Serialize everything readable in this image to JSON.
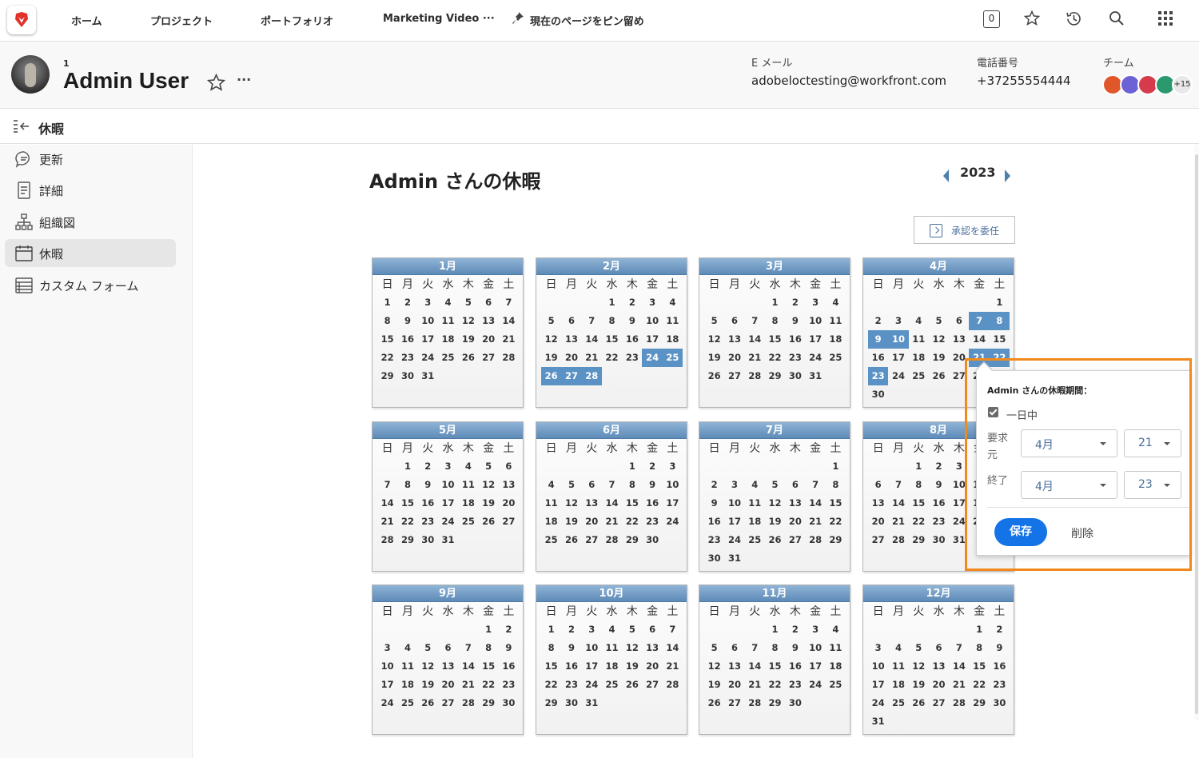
{
  "nav": {
    "items": [
      "ホーム",
      "プロジェクト",
      "ポートフォリオ",
      "Marketing Video ···"
    ],
    "pin_label": "現在のページをピン留め",
    "badge_count": "0",
    "icons": [
      "brand-logo-icon",
      "pin-icon",
      "star-icon",
      "history-icon",
      "search-icon",
      "apps-grid-icon"
    ]
  },
  "header": {
    "small_number": "1",
    "user_name": "Admin User",
    "more_label": "···",
    "email_label": "E メール",
    "email_value": "adobeloctesting@workfront.com",
    "phone_label": "電話番号",
    "phone_value": "+37255554444",
    "team_label": "チーム",
    "team_more": "+15",
    "team_colors": [
      "#e0572a",
      "#6b62d6",
      "#d63b4d",
      "#2a9a6e"
    ]
  },
  "section": {
    "title": "休暇"
  },
  "sidebar": {
    "items": [
      {
        "label": "更新",
        "icon": "chat-bubble-icon"
      },
      {
        "label": "詳細",
        "icon": "document-icon"
      },
      {
        "label": "組織図",
        "icon": "org-chart-icon"
      },
      {
        "label": "休暇",
        "icon": "calendar-icon",
        "active": true
      },
      {
        "label": "カスタム フォーム",
        "icon": "form-icon"
      }
    ]
  },
  "main": {
    "title": "Admin さんの休暇",
    "year": "2023",
    "delegate_label": "承認を委任",
    "weekdays": [
      "日",
      "月",
      "火",
      "水",
      "木",
      "金",
      "土"
    ],
    "months": [
      {
        "name": "1月",
        "offset": 0,
        "days": 31,
        "selected": []
      },
      {
        "name": "2月",
        "offset": 3,
        "days": 28,
        "selected": [
          24,
          25,
          26,
          27,
          28
        ]
      },
      {
        "name": "3月",
        "offset": 3,
        "days": 31,
        "selected": []
      },
      {
        "name": "4月",
        "offset": 6,
        "days": 30,
        "selected": [
          7,
          8,
          9,
          10,
          21,
          22,
          23
        ]
      },
      {
        "name": "5月",
        "offset": 1,
        "days": 31,
        "selected": []
      },
      {
        "name": "6月",
        "offset": 4,
        "days": 30,
        "selected": []
      },
      {
        "name": "7月",
        "offset": 6,
        "days": 31,
        "selected": []
      },
      {
        "name": "8月",
        "offset": 2,
        "days": 31,
        "selected": []
      },
      {
        "name": "9月",
        "offset": 5,
        "days": 30,
        "selected": []
      },
      {
        "name": "10月",
        "offset": 0,
        "days": 31,
        "selected": []
      },
      {
        "name": "11月",
        "offset": 3,
        "days": 30,
        "selected": []
      },
      {
        "name": "12月",
        "offset": 5,
        "days": 31,
        "selected": []
      }
    ]
  },
  "popup": {
    "title": "Admin さんの休暇期間：",
    "all_day_label": "一日中",
    "all_day_checked": true,
    "from_label": "要求元",
    "from_month": "4月",
    "from_day": "21",
    "to_label": "終了",
    "to_month": "4月",
    "to_day": "23",
    "save_label": "保存",
    "delete_label": "削除"
  }
}
